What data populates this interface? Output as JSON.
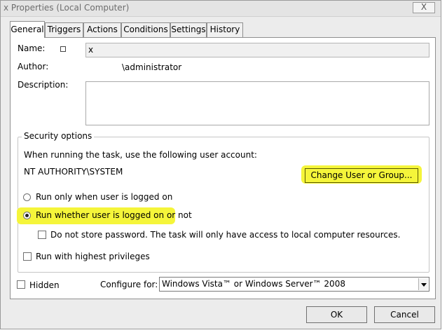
{
  "window": {
    "title": "x Properties (Local Computer)",
    "close_label": "X"
  },
  "tabs": [
    {
      "label": "General",
      "active": true
    },
    {
      "label": "Triggers"
    },
    {
      "label": "Actions"
    },
    {
      "label": "Conditions"
    },
    {
      "label": "Settings"
    },
    {
      "label": "History"
    }
  ],
  "general": {
    "name_label": "Name:",
    "name_value": "x",
    "author_label": "Author:",
    "author_value": "\\administrator",
    "description_label": "Description:",
    "description_value": ""
  },
  "security": {
    "title": "Security options",
    "account_prompt": "When running the task, use the following user account:",
    "account": "NT AUTHORITY\\SYSTEM",
    "change_user_button": "Change User or Group...",
    "radio_logged_on": "Run only when user is logged on",
    "radio_whether": "Run whether user is logged on or not",
    "selected_radio": "whether",
    "no_store_password": "Do not store password.  The task will only have access to local computer resources.",
    "highest_privileges": "Run with highest privileges"
  },
  "bottom": {
    "hidden_label": "Hidden",
    "configure_label": "Configure for:",
    "configure_value": "Windows Vista™ or Windows Server™ 2008"
  },
  "buttons": {
    "ok": "OK",
    "cancel": "Cancel"
  },
  "colors": {
    "highlight": "#f5f53a",
    "window_bg": "#ececec",
    "panel_bg": "#ffffff"
  }
}
